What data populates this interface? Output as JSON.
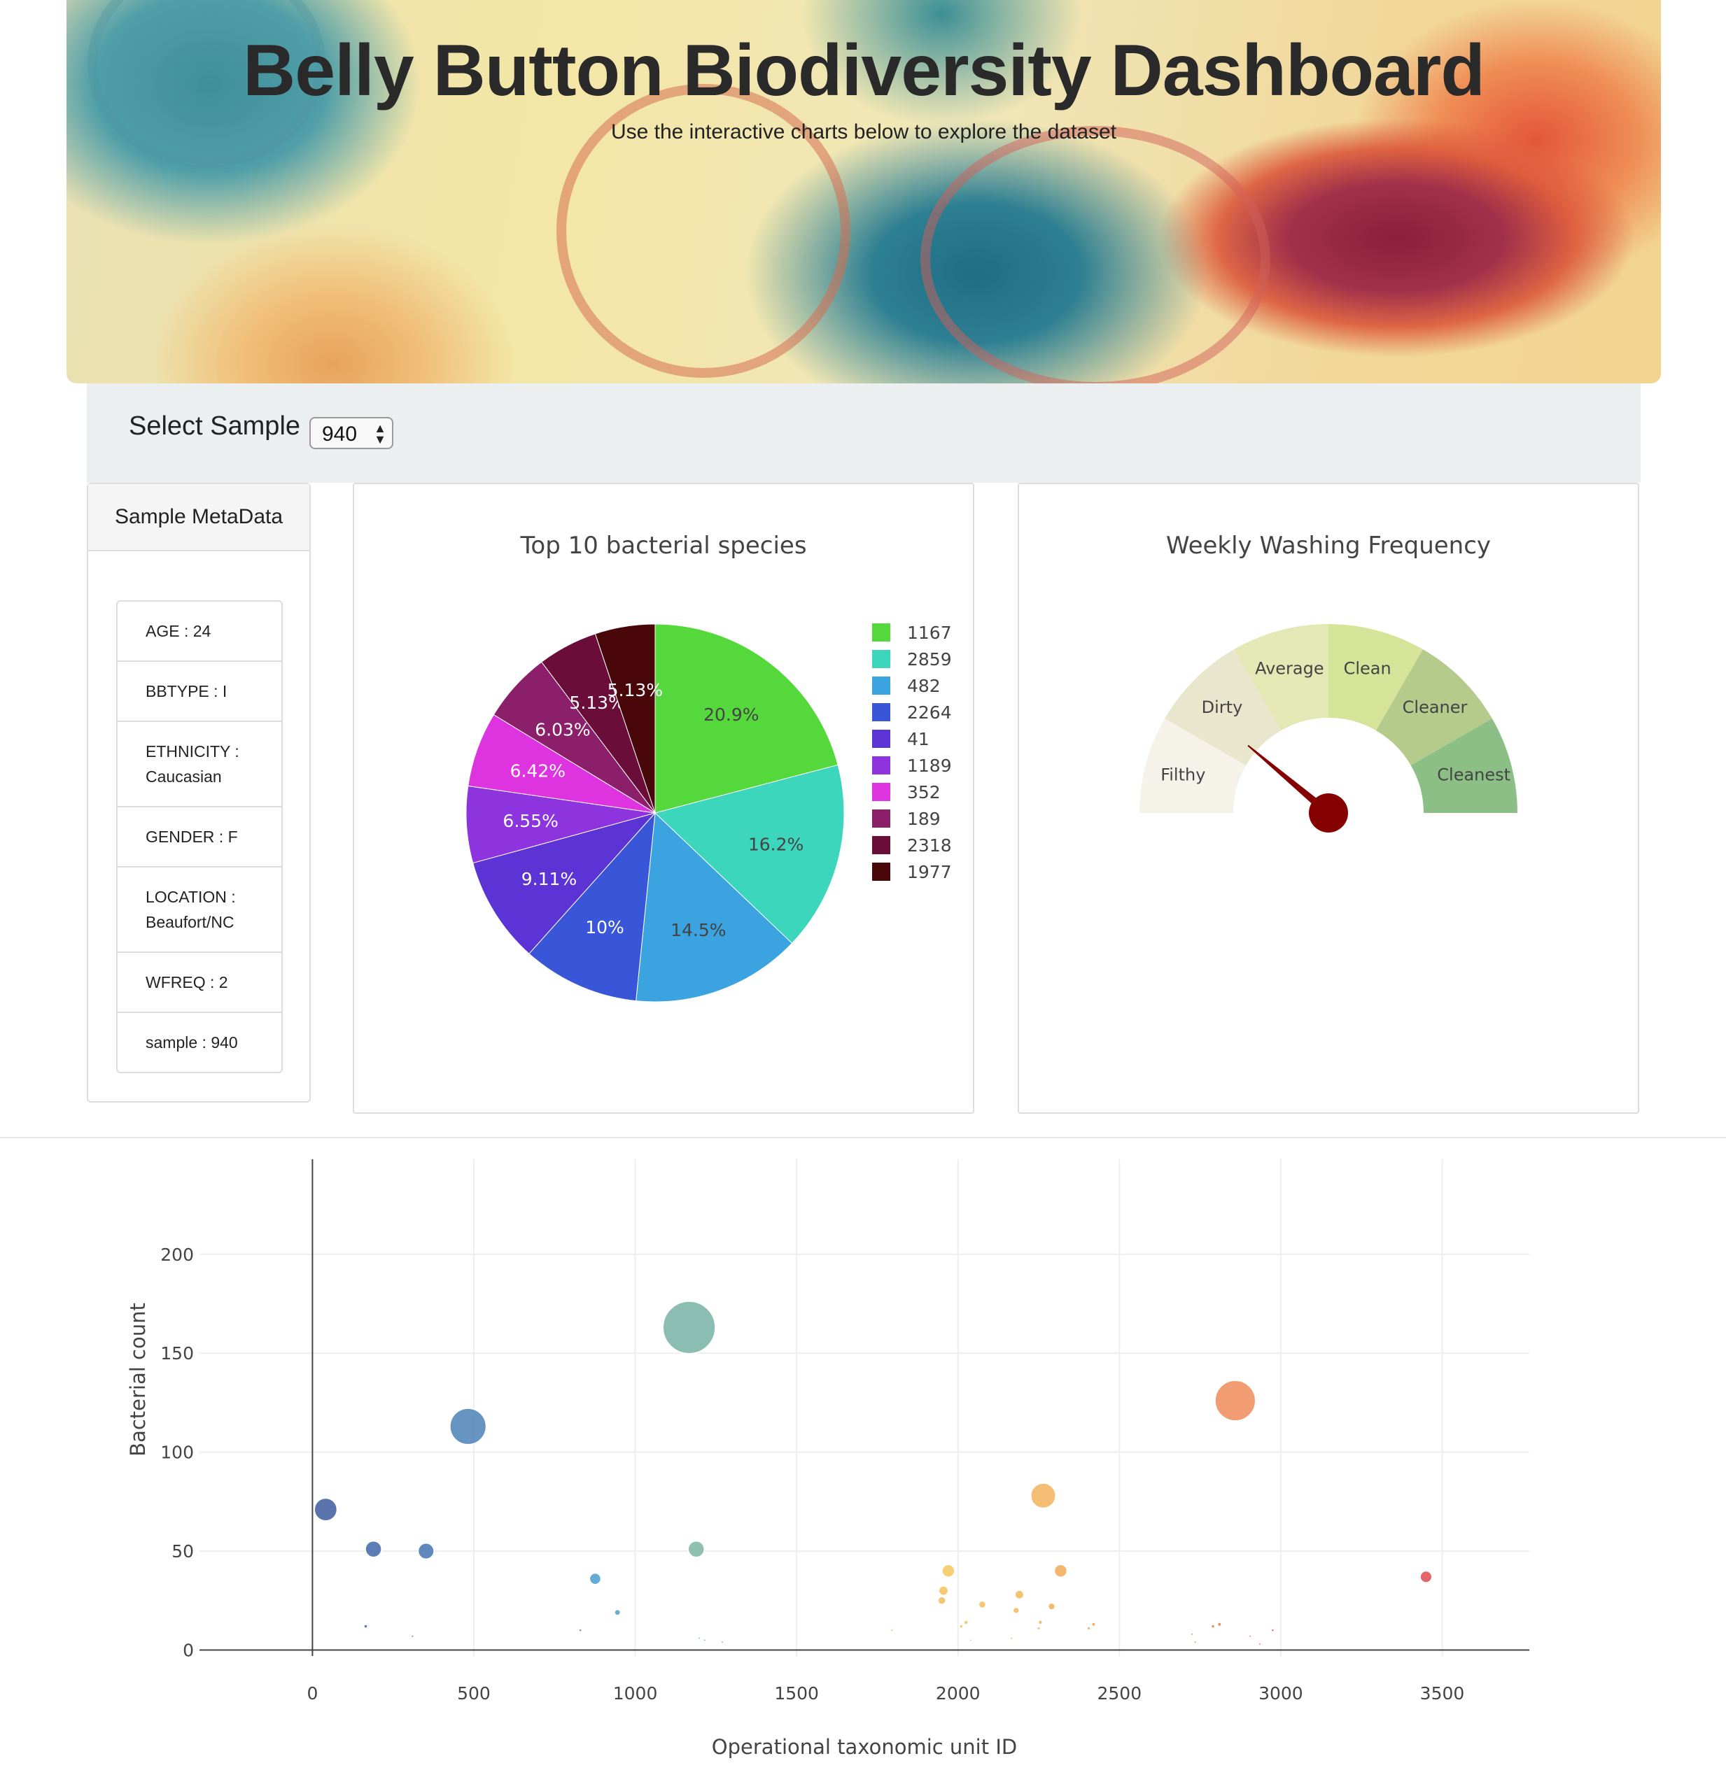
{
  "header": {
    "title": "Belly Button Biodiversity Dashboard",
    "subtitle": "Use the interactive charts below to explore the dataset"
  },
  "selector": {
    "label": "Select Sample",
    "value": "940"
  },
  "metadata": {
    "heading": "Sample MetaData",
    "items": [
      {
        "text": "AGE : 24"
      },
      {
        "text": "BBTYPE : I"
      },
      {
        "text": "ETHNICITY : Caucasian"
      },
      {
        "text": "GENDER : F"
      },
      {
        "text": "LOCATION : Beaufort/NC"
      },
      {
        "text": "WFREQ : 2"
      },
      {
        "text": "sample : 940"
      }
    ]
  },
  "chart_data": [
    {
      "type": "pie",
      "title": "Top 10 bacterial species",
      "labels": [
        "1167",
        "2859",
        "482",
        "2264",
        "41",
        "1189",
        "352",
        "189",
        "2318",
        "1977"
      ],
      "percent_labels": [
        "20.9%",
        "16.2%",
        "14.5%",
        "10%",
        "9.11%",
        "6.55%",
        "6.42%",
        "6.03%",
        "5.13%",
        "5.13%"
      ],
      "values": [
        20.9,
        16.2,
        14.5,
        10.0,
        9.11,
        6.55,
        6.42,
        6.03,
        5.13,
        5.13
      ],
      "colors": [
        "#55d83c",
        "#3cd6bd",
        "#3aa3e0",
        "#3a56d8",
        "#5c34d6",
        "#8e34de",
        "#dd34e0",
        "#8c1f6a",
        "#6a0d38",
        "#4a0709"
      ],
      "legend": "right"
    },
    {
      "type": "gauge",
      "title": "Weekly Washing Frequency",
      "range": [
        0,
        9
      ],
      "value": 2,
      "sectors": [
        {
          "label": "Filthy",
          "color": "#f4f2e9"
        },
        {
          "label": "Dirty",
          "color": "#e8e6cc"
        },
        {
          "label": "Average",
          "color": "#e3e8b4"
        },
        {
          "label": "Clean",
          "color": "#d6e49a"
        },
        {
          "label": "Cleaner",
          "color": "#b4cb8c"
        },
        {
          "label": "Cleanest",
          "color": "#8bbf85"
        }
      ],
      "needle_color": "#850000"
    },
    {
      "type": "scatter",
      "title": "",
      "xlabel": "Operational taxonomic unit ID",
      "ylabel": "Bacterial count",
      "xlim": [
        -350,
        3770
      ],
      "ylim": [
        -3,
        248
      ],
      "xticks": [
        0,
        500,
        1000,
        1500,
        2000,
        2500,
        3000,
        3500
      ],
      "yticks": [
        0,
        50,
        100,
        150,
        200
      ],
      "grid": true,
      "points": [
        {
          "x": 41,
          "y": 71,
          "c": "#3d5a9e"
        },
        {
          "x": 189,
          "y": 51,
          "c": "#3f66a8"
        },
        {
          "x": 352,
          "y": 50,
          "c": "#4473b0"
        },
        {
          "x": 482,
          "y": 113,
          "c": "#4b83b6"
        },
        {
          "x": 165,
          "y": 12,
          "c": "#3f63a8"
        },
        {
          "x": 310,
          "y": 7,
          "c": "#4370ae"
        },
        {
          "x": 876,
          "y": 36,
          "c": "#4a9ccf"
        },
        {
          "x": 830,
          "y": 10,
          "c": "#4a96c8"
        },
        {
          "x": 945,
          "y": 19,
          "c": "#4d9ecc"
        },
        {
          "x": 1167,
          "y": 163,
          "c": "#78b2a6"
        },
        {
          "x": 1189,
          "y": 51,
          "c": "#7cb5a2"
        },
        {
          "x": 1198,
          "y": 6,
          "c": "#7ab3a5"
        },
        {
          "x": 1215,
          "y": 5,
          "c": "#7ab3a5"
        },
        {
          "x": 1270,
          "y": 4,
          "c": "#7ab3a5"
        },
        {
          "x": 1795,
          "y": 10,
          "c": "#f0d36e"
        },
        {
          "x": 1970,
          "y": 40,
          "c": "#f4c55a"
        },
        {
          "x": 1955,
          "y": 30,
          "c": "#f3c25a"
        },
        {
          "x": 1950,
          "y": 25,
          "c": "#f2be58"
        },
        {
          "x": 2025,
          "y": 14,
          "c": "#f3c258"
        },
        {
          "x": 2010,
          "y": 12,
          "c": "#f3c258"
        },
        {
          "x": 2075,
          "y": 23,
          "c": "#f2bd57"
        },
        {
          "x": 2190,
          "y": 28,
          "c": "#f2b957"
        },
        {
          "x": 2180,
          "y": 20,
          "c": "#f2b957"
        },
        {
          "x": 2255,
          "y": 14,
          "c": "#f2b657"
        },
        {
          "x": 2250,
          "y": 11,
          "c": "#f2b657"
        },
        {
          "x": 2264,
          "y": 78,
          "c": "#f2b45c"
        },
        {
          "x": 2318,
          "y": 40,
          "c": "#f1aa57"
        },
        {
          "x": 2290,
          "y": 22,
          "c": "#f1ad57"
        },
        {
          "x": 2405,
          "y": 11,
          "c": "#f09f55"
        },
        {
          "x": 2420,
          "y": 13,
          "c": "#f09f55"
        },
        {
          "x": 2859,
          "y": 126,
          "c": "#ee8b5a"
        },
        {
          "x": 2725,
          "y": 8,
          "c": "#ea7f4c"
        },
        {
          "x": 2790,
          "y": 12,
          "c": "#ea7b4c"
        },
        {
          "x": 2810,
          "y": 13,
          "c": "#e97a4c"
        },
        {
          "x": 2905,
          "y": 7,
          "c": "#e8744a"
        },
        {
          "x": 2975,
          "y": 10,
          "c": "#e6704a"
        },
        {
          "x": 3450,
          "y": 37,
          "c": "#df4a4f"
        },
        {
          "x": 2165,
          "y": 6,
          "c": "#f2b957"
        },
        {
          "x": 2040,
          "y": 5,
          "c": "#f3c258"
        },
        {
          "x": 2735,
          "y": 4,
          "c": "#ea7f4c"
        },
        {
          "x": 2935,
          "y": 3,
          "c": "#e8744a"
        }
      ]
    }
  ]
}
